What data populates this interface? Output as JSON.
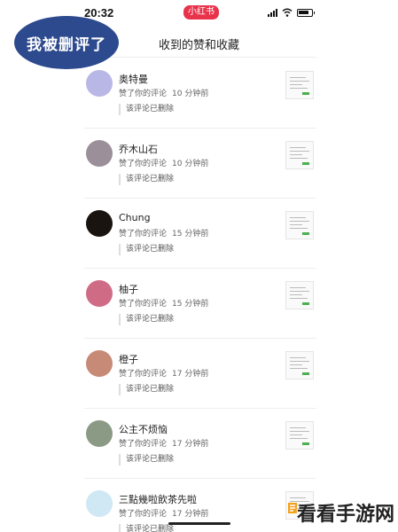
{
  "status_bar": {
    "time": "20:32",
    "app_badge": "小红书"
  },
  "header": {
    "title": "收到的赞和收藏"
  },
  "overlay": {
    "text": "我被删评了"
  },
  "items": [
    {
      "name": "奥特曼",
      "action": "赞了你的评论",
      "time": "10 分钟前",
      "note": "该评论已删除",
      "avatar_color": "#b9b7e6"
    },
    {
      "name": "乔木山石",
      "action": "赞了你的评论",
      "time": "10 分钟前",
      "note": "该评论已删除",
      "avatar_color": "#9b8f9a"
    },
    {
      "name": "Chung",
      "action": "赞了你的评论",
      "time": "15 分钟前",
      "note": "该评论已删除",
      "avatar_color": "#1a1410"
    },
    {
      "name": "柚子",
      "action": "赞了你的评论",
      "time": "15 分钟前",
      "note": "该评论已删除",
      "avatar_color": "#d06b86"
    },
    {
      "name": "橙子",
      "action": "赞了你的评论",
      "time": "17 分钟前",
      "note": "该评论已删除",
      "avatar_color": "#c78a76"
    },
    {
      "name": "公主不烦恼",
      "action": "赞了你的评论",
      "time": "17 分钟前",
      "note": "该评论已删除",
      "avatar_color": "#8a9a84"
    },
    {
      "name": "三點幾啦飲茶先啦",
      "action": "赞了你的评论",
      "time": "17 分钟前",
      "note": "该评论已删除",
      "avatar_color": "#cfe8f4"
    }
  ],
  "watermark": {
    "text": "看看手游网"
  }
}
